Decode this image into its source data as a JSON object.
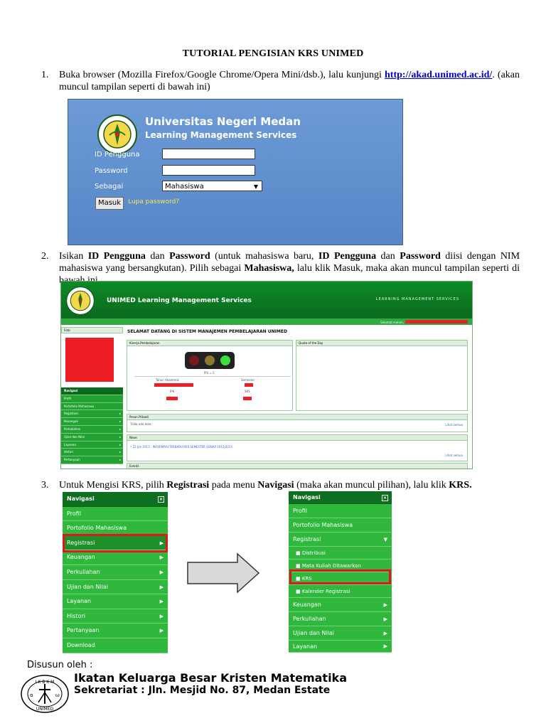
{
  "title": "TUTORIAL PENGISIAN KRS UNIMED",
  "step1": {
    "num": "1.",
    "text_before": "Buka browser (Mozilla Firefox/Google Chrome/Opera Mini/dsb.), lalu kunjungi ",
    "link": "http://akad.unimed.ac.id/",
    "text_after": ". (akan muncul tampilan seperti di bawah ini)"
  },
  "login": {
    "title": "Universitas Negeri Medan",
    "subtitle": "Learning Management Services",
    "id_label": "ID Pengguna",
    "password_label": "Password",
    "sebagai_label": "Sebagai",
    "sebagai_value": "Mahasiswa",
    "masuk_button": "Masuk",
    "lupa_link": "Lupa password?"
  },
  "step2": {
    "num": "2.",
    "t1": "Isikan ",
    "b1": "ID Pengguna",
    "t2": " dan ",
    "b2": "Password",
    "t3": " (untuk mahasiswa baru, ",
    "b3": "ID Pengguna",
    "t4": " dan ",
    "b4": "Password",
    "t5": " diisi dengan NIM mahasiswa yang bersangkutan). Pilih sebagai ",
    "b5": "Mahasiswa,",
    "t6": " lalu klik Masuk, maka akan muncul tampilan seperti di bawah ini."
  },
  "dash": {
    "title": "UNIMED Learning Management Services",
    "right_title": "LEARNING MANAGEMENT SERVICES",
    "menu": [
      "BERANDA",
      "GANTI PASSWORD",
      "KELUAR"
    ],
    "welcome": "Selamat malam,",
    "foto": "Foto",
    "heading": "SELAMAT DATANG DI SISTEM MANAJEMEN PEMBELAJARAN UNIMED",
    "kinerja": "Kinerja Pembelajaran",
    "quote": "Quote of the Day",
    "ips": "IPS = 2",
    "tahun": "Tahun Akademik",
    "semester": "Semester",
    "ipk": "IPK",
    "sks": "SKS",
    "nav": [
      "Navigasi",
      "Profil",
      "Portofolio Mahasiswa",
      "Registrasi",
      "Keuangan",
      "Perkuliahan",
      "Ujian dan Nilai",
      "Layanan",
      "Histori",
      "Pertanyaan"
    ],
    "pesan": "Pesan Pribadi",
    "pesan_text": "Tidak ada data",
    "lihat": "Lihat semua",
    "news": "News",
    "news_text": "• 22 Jan 2013 : INFORMASI TERBARU KRS SEMESTER GENAP 2012/2013",
    "events": "Events"
  },
  "step3": {
    "num": "3.",
    "t1": "Untuk Mengisi KRS, pilih ",
    "b1": "Registrasi",
    "t2": " pada menu ",
    "b2": "Navigasi",
    "t3": " (maka akan muncul pilihan),  lalu klik ",
    "b3": "KRS."
  },
  "menu_left": [
    "Navigasi",
    "Profil",
    "Portofolio Mahasiswa",
    "Registrasi",
    "Keuangan",
    "Perkuliahan",
    "Ujian dan Nilai",
    "Layanan",
    "Histori",
    "Pertanyaan",
    "Download"
  ],
  "menu_right": [
    "Navigasi",
    "Profil",
    "Portofolio Mahasiswa",
    "Registrasi",
    "Distribusi",
    "Mata Kuliah Ditawarkan",
    "KRS",
    "Kalender Registrasi",
    "Keuangan",
    "Perkuliahan",
    "Ujian dan Nilai",
    "Layanan"
  ],
  "footer": {
    "label": "Disusun oleh :",
    "line1": "Ikatan Keluarga Besar Kristen Matematika",
    "line2": "Sekretariat : Jln. Mesjid No. 87, Medan Estate",
    "logo_text": "IKBKM UNIMED"
  },
  "colors": {
    "green_dark": "#0d7020",
    "green": "#2fb83c",
    "highlight_red": "#e2161e",
    "login_blue": "#6d9bd8",
    "link_blue": "#0000cc"
  }
}
